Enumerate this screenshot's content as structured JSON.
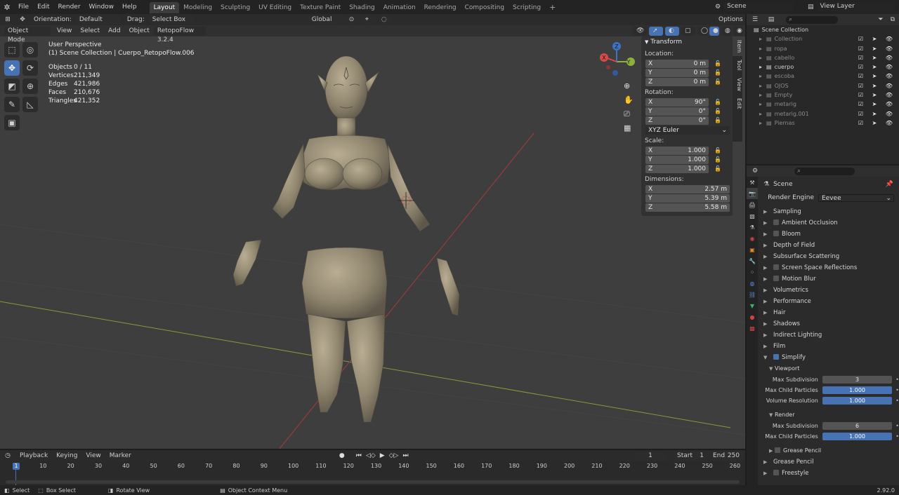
{
  "menu": [
    "File",
    "Edit",
    "Render",
    "Window",
    "Help"
  ],
  "workspaces": [
    "Layout",
    "Modeling",
    "Sculpting",
    "UV Editing",
    "Texture Paint",
    "Shading",
    "Animation",
    "Rendering",
    "Compositing",
    "Scripting"
  ],
  "workspace_add": "+",
  "scene_name": "Scene",
  "view_layer": "View Layer",
  "vp_header": {
    "orientation_label": "Orientation:",
    "orientation_value": "Default",
    "drag_label": "Drag:",
    "drag_value": "Select Box",
    "transform_orientation": "Global",
    "options": "Options"
  },
  "vp_header2": {
    "mode": "Object Mode",
    "view": "View",
    "select": "Select",
    "add": "Add",
    "object": "Object",
    "addon": "RetopoFlow 3.2.4"
  },
  "overlay": {
    "perspective": "User Perspective",
    "collection": "(1) Scene Collection | Cuerpo_RetopoFlow.006",
    "stats": [
      {
        "k": "Objects",
        "v": "0 / 11"
      },
      {
        "k": "Vertices",
        "v": "211,349"
      },
      {
        "k": "Edges",
        "v": "421,986"
      },
      {
        "k": "Faces",
        "v": "210,676"
      },
      {
        "k": "Triangles",
        "v": "421,352"
      }
    ]
  },
  "gizmo": {
    "x": "X",
    "y": "Y",
    "z": "Z"
  },
  "npanel": {
    "title": "Transform",
    "location_label": "Location:",
    "location": [
      {
        "a": "X",
        "v": "0 m"
      },
      {
        "a": "Y",
        "v": "0 m"
      },
      {
        "a": "Z",
        "v": "0 m"
      }
    ],
    "rotation_label": "Rotation:",
    "rotation": [
      {
        "a": "X",
        "v": "90°"
      },
      {
        "a": "Y",
        "v": "0°"
      },
      {
        "a": "Z",
        "v": "0°"
      }
    ],
    "rotation_mode": "XYZ Euler",
    "scale_label": "Scale:",
    "scale": [
      {
        "a": "X",
        "v": "1.000"
      },
      {
        "a": "Y",
        "v": "1.000"
      },
      {
        "a": "Z",
        "v": "1.000"
      }
    ],
    "dimensions_label": "Dimensions:",
    "dimensions": [
      {
        "a": "X",
        "v": "2.57 m"
      },
      {
        "a": "Y",
        "v": "5.39 m"
      },
      {
        "a": "Z",
        "v": "5.58 m"
      }
    ],
    "tabs": [
      "Item",
      "Tool",
      "View",
      "Edit"
    ]
  },
  "outliner": {
    "root": "Scene Collection",
    "items": [
      {
        "name": "Collection",
        "dim": true
      },
      {
        "name": "ropa",
        "dim": true
      },
      {
        "name": "cabello",
        "dim": true
      },
      {
        "name": "cuerpo",
        "dim": false
      },
      {
        "name": "escoba",
        "dim": true
      },
      {
        "name": "OJOS",
        "dim": true
      },
      {
        "name": "Empty",
        "dim": true
      },
      {
        "name": "metarig",
        "dim": true
      },
      {
        "name": "metarig.001",
        "dim": true
      },
      {
        "name": "Piernas",
        "dim": true
      }
    ]
  },
  "properties": {
    "scene": "Scene",
    "render_engine_label": "Render Engine",
    "render_engine": "Eevee",
    "sections": [
      {
        "label": "Sampling",
        "check": null
      },
      {
        "label": "Ambient Occlusion",
        "check": false
      },
      {
        "label": "Bloom",
        "check": false
      },
      {
        "label": "Depth of Field",
        "check": null
      },
      {
        "label": "Subsurface Scattering",
        "check": null
      },
      {
        "label": "Screen Space Reflections",
        "check": false
      },
      {
        "label": "Motion Blur",
        "check": false
      },
      {
        "label": "Volumetrics",
        "check": null
      },
      {
        "label": "Performance",
        "check": null
      },
      {
        "label": "Hair",
        "check": null
      },
      {
        "label": "Shadows",
        "check": null
      },
      {
        "label": "Indirect Lighting",
        "check": null
      },
      {
        "label": "Film",
        "check": null
      }
    ],
    "simplify": "Simplify",
    "viewport_sub": "Viewport",
    "viewport_rows": [
      {
        "label": "Max Subdivision",
        "value": "3",
        "blue": false
      },
      {
        "label": "Max Child Particles",
        "value": "1.000",
        "blue": true
      },
      {
        "label": "Volume Resolution",
        "value": "1.000",
        "blue": true
      }
    ],
    "render_sub": "Render",
    "render_rows": [
      {
        "label": "Max Subdivision",
        "value": "6",
        "blue": false
      },
      {
        "label": "Max Child Particles",
        "value": "1.000",
        "blue": true
      }
    ],
    "grease_pencil_sub": "Grease Pencil",
    "grease_pencil": "Grease Pencil",
    "freestyle": "Freestyle"
  },
  "timeline": {
    "playback": "Playback",
    "keying": "Keying",
    "view": "View",
    "marker": "Marker",
    "current": "1",
    "start_label": "Start",
    "start": "1",
    "end_label": "End",
    "end": "250",
    "ticks": [
      "10",
      "20",
      "30",
      "40",
      "50",
      "60",
      "70",
      "80",
      "90",
      "100",
      "110",
      "120",
      "130",
      "140",
      "150",
      "160",
      "170",
      "180",
      "190",
      "200",
      "210",
      "220",
      "230",
      "240",
      "250",
      "260"
    ],
    "playhead": "1"
  },
  "status": {
    "select": "Select",
    "box_select": "Box Select",
    "rotate_view": "Rotate View",
    "context_menu": "Object Context Menu",
    "version": "2.92.0"
  }
}
